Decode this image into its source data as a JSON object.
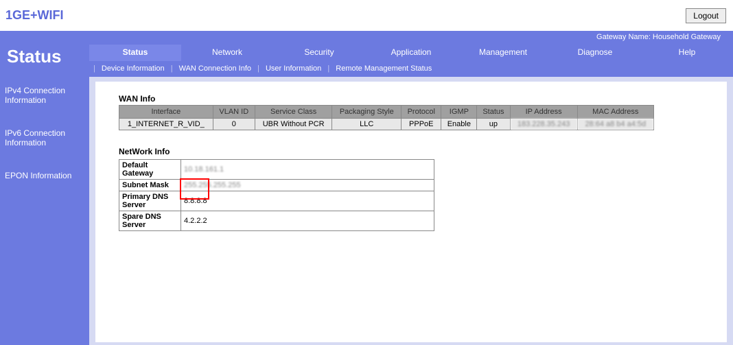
{
  "header": {
    "logo": "1GE+WIFI",
    "logout": "Logout"
  },
  "gateway_bar": "Gateway Name: Household Gateway",
  "sidebar": {
    "title": "Status",
    "items": [
      "IPv4 Connection Information",
      "IPv6 Connection Information",
      "EPON Information"
    ]
  },
  "tabs": [
    "Status",
    "Network",
    "Security",
    "Application",
    "Management",
    "Diagnose",
    "Help"
  ],
  "tabs_active": 0,
  "subtabs": [
    "Device Information",
    "WAN Connection Info",
    "User Information",
    "Remote Management Status"
  ],
  "wan_info": {
    "title": "WAN Info",
    "headers": [
      "Interface",
      "VLAN ID",
      "Service Class",
      "Packaging Style",
      "Protocol",
      "IGMP",
      "Status",
      "IP Address",
      "MAC Address"
    ],
    "row": {
      "interface": "1_INTERNET_R_VID_",
      "vlan": "0",
      "service": "UBR Without PCR",
      "pkg": "LLC",
      "proto": "PPPoE",
      "igmp": "Enable",
      "status": "up",
      "ip": "183.228.35.243",
      "mac": "28:64 a8 b4 a4:5d"
    }
  },
  "network_info": {
    "title": "NetWork Info",
    "rows": [
      {
        "k": "Default Gateway",
        "v": "10.18.161.1"
      },
      {
        "k": "Subnet Mask",
        "v": "255.255.255.255"
      },
      {
        "k": "Primary DNS Server",
        "v": "8.8.8.8"
      },
      {
        "k": "Spare DNS Server",
        "v": "4.2.2.2"
      }
    ]
  }
}
